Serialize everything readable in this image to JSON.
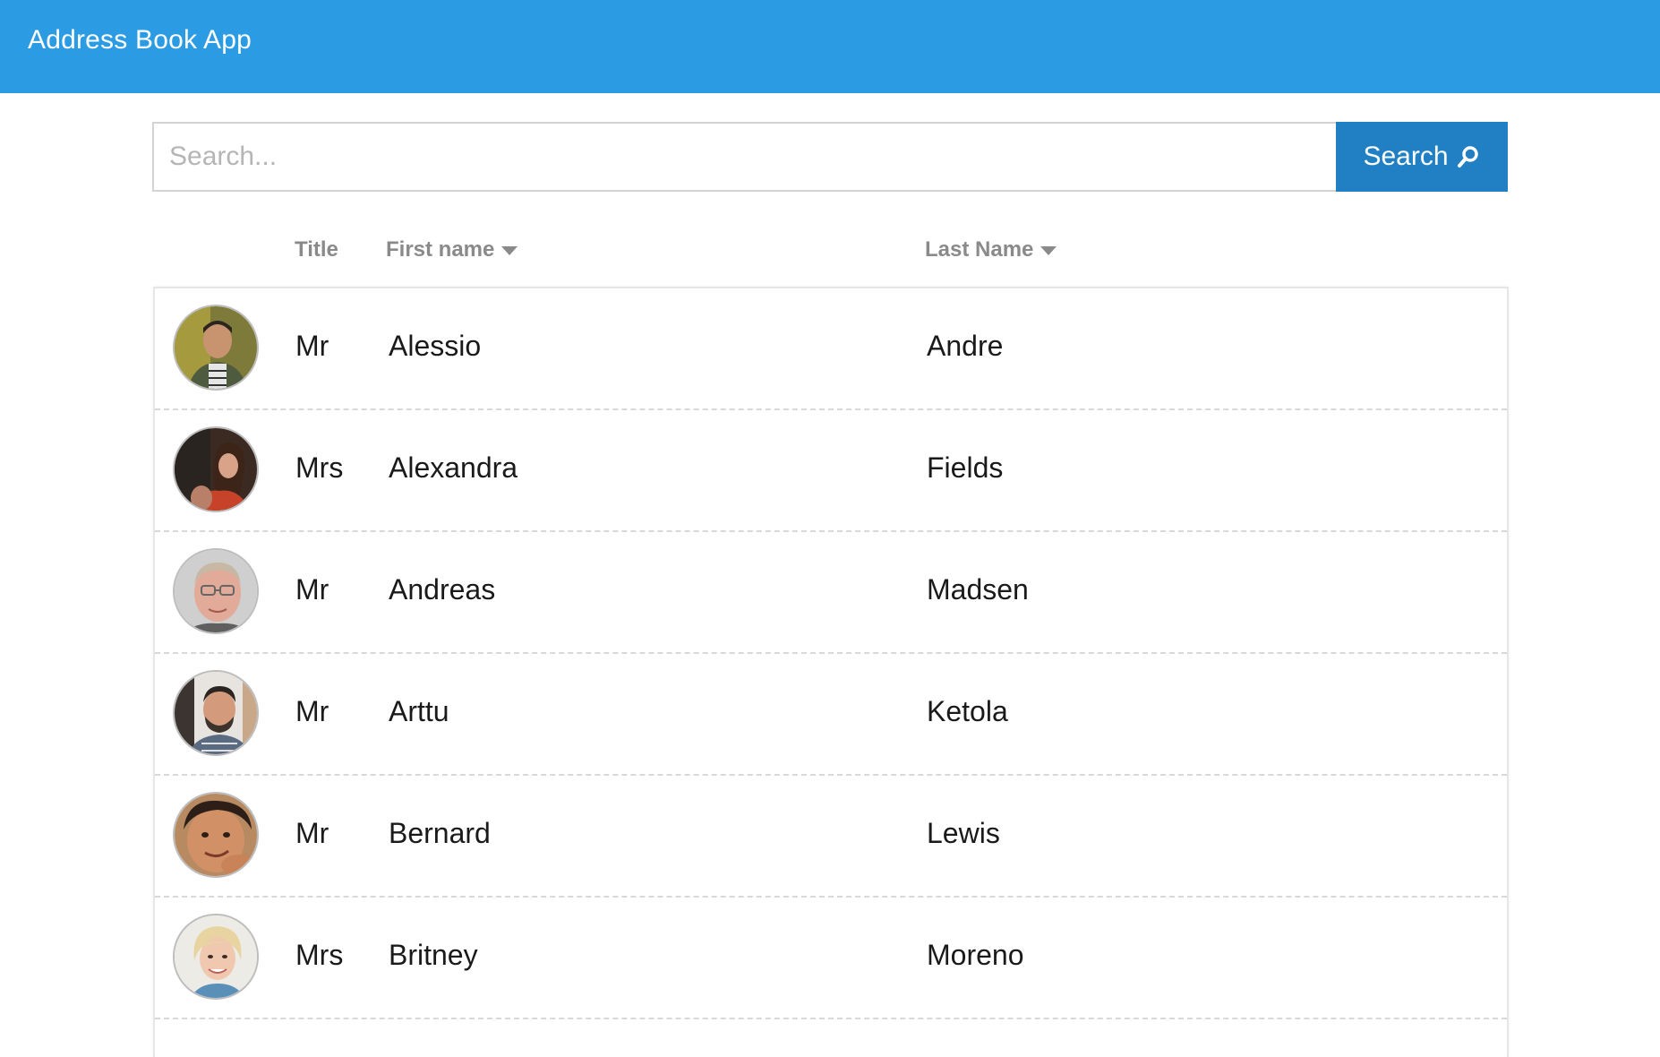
{
  "header": {
    "title": "Address Book App",
    "color": "#2b9be3"
  },
  "search": {
    "placeholder": "Search...",
    "value": "",
    "button_label": "Search",
    "button_color": "#2180c4",
    "button_icon": "magnifier-icon"
  },
  "columns": {
    "title": "Title",
    "first_name": "First name",
    "last_name": "Last Name",
    "first_name_sort_icon": "caret-down-icon",
    "last_name_sort_icon": "caret-down-icon"
  },
  "contacts": [
    {
      "title": "Mr",
      "first_name": "Alessio",
      "last_name": "Andre",
      "avatar": "avatar-photo"
    },
    {
      "title": "Mrs",
      "first_name": "Alexandra",
      "last_name": "Fields",
      "avatar": "avatar-photo"
    },
    {
      "title": "Mr",
      "first_name": "Andreas",
      "last_name": "Madsen",
      "avatar": "avatar-photo"
    },
    {
      "title": "Mr",
      "first_name": "Arttu",
      "last_name": "Ketola",
      "avatar": "avatar-photo"
    },
    {
      "title": "Mr",
      "first_name": "Bernard",
      "last_name": "Lewis",
      "avatar": "avatar-photo"
    },
    {
      "title": "Mrs",
      "first_name": "Britney",
      "last_name": "Moreno",
      "avatar": "avatar-photo"
    }
  ]
}
